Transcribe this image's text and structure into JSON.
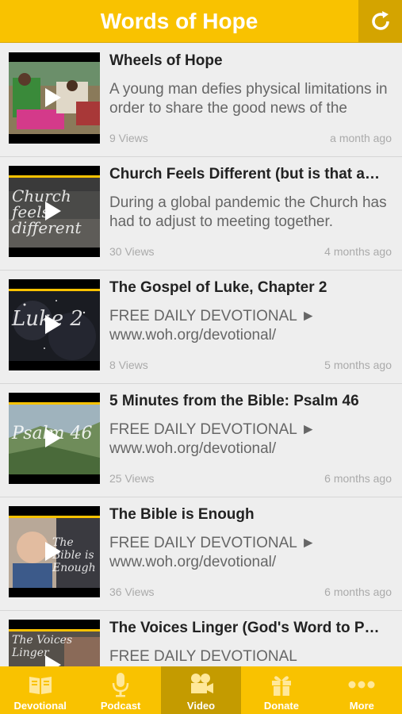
{
  "header": {
    "title": "Words of Hope"
  },
  "videos": [
    {
      "title": "Wheels of Hope",
      "description": "A young man defies physical limitations in order to share the good news of the",
      "views": "9 Views",
      "time": "a month ago",
      "thumb_text": ""
    },
    {
      "title": "Church Feels Different (but is that a…",
      "description": "During a global pandemic the Church has had to adjust to meeting together.",
      "views": "30 Views",
      "time": "4 months ago",
      "thumb_text": "Church feels different"
    },
    {
      "title": "The Gospel of Luke, Chapter 2",
      "description": "FREE DAILY DEVOTIONAL ► www.woh.org/devotional/",
      "views": "8 Views",
      "time": "5 months ago",
      "thumb_text": "Luke 2"
    },
    {
      "title": "5 Minutes from the Bible: Psalm 46",
      "description": "FREE DAILY DEVOTIONAL ► www.woh.org/devotional/",
      "views": "25 Views",
      "time": "6 months ago",
      "thumb_text": "Psalm 46"
    },
    {
      "title": "The Bible is Enough",
      "description": "FREE DAILY DEVOTIONAL ► www.woh.org/devotional/",
      "views": "36 Views",
      "time": "6 months ago",
      "thumb_text": "The Bible is Enough"
    },
    {
      "title": "The Voices Linger (God's Word to P…",
      "description": "FREE DAILY DEVOTIONAL",
      "views": "",
      "time": "",
      "thumb_text": "The Voices Linger"
    }
  ],
  "tabs": [
    {
      "label": "Devotional",
      "icon": "book-icon"
    },
    {
      "label": "Podcast",
      "icon": "microphone-icon"
    },
    {
      "label": "Video",
      "icon": "video-camera-icon"
    },
    {
      "label": "Donate",
      "icon": "gift-icon"
    },
    {
      "label": "More",
      "icon": "ellipsis-icon"
    }
  ],
  "colors": {
    "accent": "#f9c200",
    "active_tab": "#c49b00",
    "background": "#eeeeee"
  }
}
